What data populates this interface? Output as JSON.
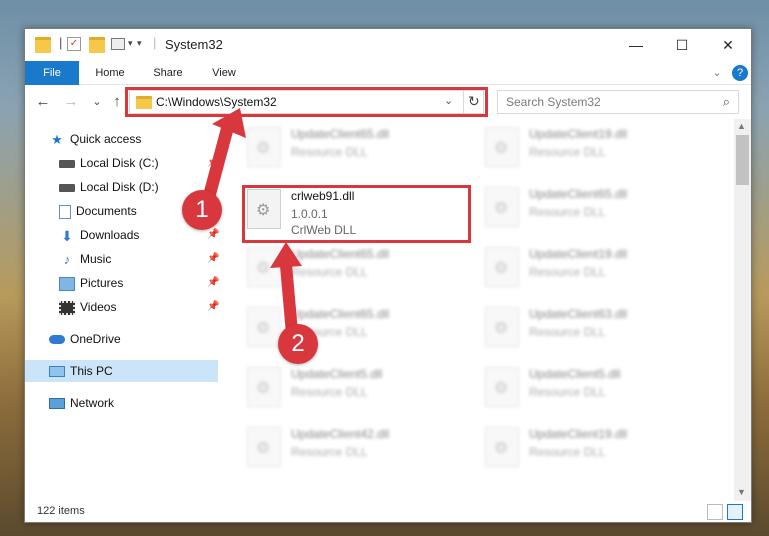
{
  "window": {
    "title": "System32",
    "minimize": "—",
    "maximize": "☐",
    "close": "✕"
  },
  "ribbon": {
    "tabs": [
      "File",
      "Home",
      "Share",
      "View"
    ],
    "collapse": "⌄",
    "help": "?"
  },
  "address": {
    "path": "C:\\Windows\\System32",
    "dropdown": "⌄",
    "refresh": "↻"
  },
  "search": {
    "placeholder": "Search System32",
    "icon": "⌕"
  },
  "nav": {
    "back": "←",
    "forward": "→",
    "recent": "⌄",
    "up": "↑"
  },
  "sidebar": {
    "items": [
      {
        "label": "Quick access",
        "icon": "star-icon",
        "pinned": false
      },
      {
        "label": "Local Disk (C:)",
        "icon": "drive-icon",
        "pinned": true
      },
      {
        "label": "Local Disk (D:)",
        "icon": "drive-icon",
        "pinned": true
      },
      {
        "label": "Documents",
        "icon": "documents-icon",
        "pinned": true
      },
      {
        "label": "Downloads",
        "icon": "downloads-icon",
        "pinned": true
      },
      {
        "label": "Music",
        "icon": "music-icon",
        "pinned": true
      },
      {
        "label": "Pictures",
        "icon": "pictures-icon",
        "pinned": true
      },
      {
        "label": "Videos",
        "icon": "videos-icon",
        "pinned": true
      },
      {
        "label": "OneDrive",
        "icon": "cloud-icon",
        "pinned": false
      },
      {
        "label": "This PC",
        "icon": "computer-icon",
        "pinned": false,
        "selected": true
      },
      {
        "label": "Network",
        "icon": "network-icon",
        "pinned": false
      }
    ],
    "pin_glyph": "📌"
  },
  "files": {
    "highlighted": {
      "name": "crlweb91.dll",
      "version": "1.0.0.1",
      "desc": "CrlWeb DLL"
    },
    "col1": [
      {
        "name": "UpdateClient65.dll",
        "desc": "Resource DLL"
      },
      {
        "name": "UpdateClient65.dll",
        "desc": "Resource DLL"
      },
      {
        "name": "UpdateClient65.dll",
        "desc": "Resource DLL"
      },
      {
        "name": "UpdateClient5.dll",
        "desc": "Resource DLL"
      },
      {
        "name": "UpdateClient42.dll",
        "desc": "Resource DLL"
      }
    ],
    "col2": [
      {
        "name": "UpdateClient19.dll",
        "desc": "Resource DLL"
      },
      {
        "name": "UpdateClient65.dll",
        "desc": "Resource DLL"
      },
      {
        "name": "UpdateClient19.dll",
        "desc": "Resource DLL"
      },
      {
        "name": "UpdateClient63.dll",
        "desc": "Resource DLL"
      },
      {
        "name": "UpdateClient5.dll",
        "desc": "Resource DLL"
      },
      {
        "name": "UpdateClient19.dll",
        "desc": "Resource DLL"
      }
    ]
  },
  "status": {
    "count": "122 items"
  },
  "annotations": {
    "step1": "1",
    "step2": "2",
    "color": "#d8373d"
  },
  "colors": {
    "file_tab": "#1979ca",
    "selection": "#cce4f7"
  }
}
